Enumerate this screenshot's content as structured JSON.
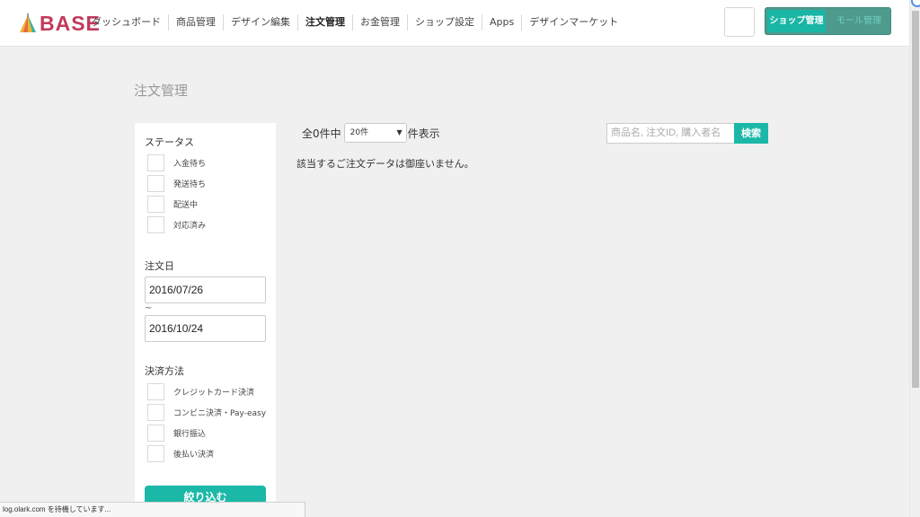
{
  "header": {
    "logo_text": "BASE",
    "nav": [
      {
        "label": "ダッシュボード"
      },
      {
        "label": "商品管理"
      },
      {
        "label": "デザイン編集"
      },
      {
        "label": "注文管理",
        "active": true
      },
      {
        "label": "お金管理"
      },
      {
        "label": "ショップ設定"
      },
      {
        "label": "Apps"
      },
      {
        "label": "デザインマーケット"
      }
    ],
    "switch": {
      "shop_label": "ショップ管理",
      "mall_label": "モール管理"
    }
  },
  "page": {
    "title": "注文管理"
  },
  "sidebar": {
    "status_label": "ステータス",
    "status_options": [
      "入金待ち",
      "発送待ち",
      "配送中",
      "対応済み"
    ],
    "date_label": "注文日",
    "date_from": "2016/07/26",
    "date_sep": "~",
    "date_to": "2016/10/24",
    "payment_label": "決済方法",
    "payment_options": [
      "クレジットカード決済",
      "コンビニ決済・Pay-easy",
      "銀行振込",
      "後払い決済"
    ],
    "filter_button": "絞り込む"
  },
  "main": {
    "count_prefix": "全0件中",
    "per_page": "20件",
    "count_suffix": "件表示",
    "empty_message": "該当するご注文データは御座いません。",
    "search_placeholder": "商品名, 注文ID, 購入者名",
    "search_button": "検索"
  },
  "statusbar": {
    "text": "log.olark.com を待機しています..."
  },
  "colors": {
    "accent": "#1bb8a8",
    "brand": "#c23a5b"
  }
}
